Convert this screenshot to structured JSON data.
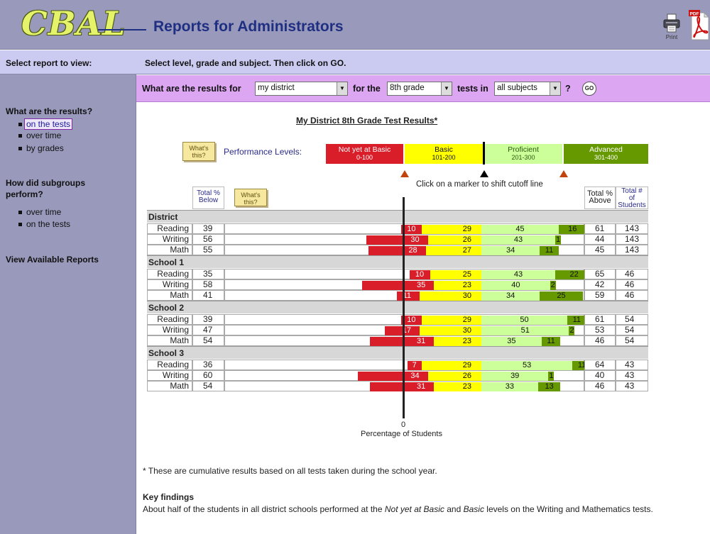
{
  "header": {
    "logo": "CBAL",
    "title": "Reports for Administrators",
    "print_label": "Print",
    "pdf_label": "PDF"
  },
  "sidebar": {
    "heading": "Select report to view:",
    "group1": "What are the results?",
    "group1_items": [
      "on the tests",
      "over time",
      "by grades"
    ],
    "group2_line1": "How did subgroups",
    "group2_line2": "perform?",
    "group2_items": [
      "over time",
      "on the tests"
    ],
    "view_reports": "View Available Reports"
  },
  "instruction": "Select level, grade and subject. Then click on GO.",
  "query": {
    "prefix": "What are the results for",
    "level": "my district",
    "mid": "for the",
    "grade": "8th grade",
    "tests_in": "tests in",
    "subject": "all subjects",
    "question": "?",
    "go": "GO"
  },
  "report": {
    "title": "My District 8th Grade Test Results*",
    "whats_this_line1": "What's",
    "whats_this_line2": "this?",
    "performance_label": "Performance Levels:",
    "levels": [
      {
        "name": "Not yet at Basic",
        "range": "0-100",
        "color": "#d91e2a",
        "text_color": "#ffffff"
      },
      {
        "name": "Basic",
        "range": "101-200",
        "color": "#ffff00",
        "text_color": "#111111"
      },
      {
        "name": "Proficient",
        "range": "201-300",
        "color": "#ccff99",
        "text_color": "#2a5a10"
      },
      {
        "name": "Advanced",
        "range": "301-400",
        "color": "#669900",
        "text_color": "#ffffff"
      }
    ],
    "marker_hint": "Click on a marker to shift cutoff line",
    "headers": {
      "total_below_1": "Total %",
      "total_below_2": "Below",
      "total_above_1": "Total %",
      "total_above_2": "Above",
      "total_students_1": "Total #",
      "total_students_2": "of",
      "total_students_3": "Students"
    },
    "axis_zero": "0",
    "axis_title": "Percentage of Students",
    "footnote": "* These are cumulative results based on all tests taken during the school year.",
    "key_title": "Key findings",
    "key_text_1": "About half of the students in all district schools performed at the ",
    "key_italic_1": "Not yet at Basic",
    "key_text_2": " and ",
    "key_italic_2": "Basic",
    "key_text_3": " levels on the Writing and Mathematics tests."
  },
  "chart_data": {
    "type": "bar",
    "title": "My District 8th Grade Test Results*",
    "xlabel": "Percentage of Students",
    "series_names": [
      "Not yet at Basic",
      "Basic",
      "Proficient",
      "Advanced"
    ],
    "groups": [
      {
        "name": "District",
        "rows": [
          {
            "subject": "Reading",
            "below": 39,
            "nyb": 10,
            "basic": 29,
            "prof": 45,
            "adv": 16,
            "above": 61,
            "students": 143
          },
          {
            "subject": "Writing",
            "below": 56,
            "nyb": 30,
            "basic": 26,
            "prof": 43,
            "adv": 1,
            "above": 44,
            "students": 143
          },
          {
            "subject": "Math",
            "below": 55,
            "nyb": 28,
            "basic": 27,
            "prof": 34,
            "adv": 11,
            "above": 45,
            "students": 143
          }
        ]
      },
      {
        "name": "School 1",
        "rows": [
          {
            "subject": "Reading",
            "below": 35,
            "nyb": 10,
            "basic": 25,
            "prof": 43,
            "adv": 22,
            "above": 65,
            "students": 46
          },
          {
            "subject": "Writing",
            "below": 58,
            "nyb": 35,
            "basic": 23,
            "prof": 40,
            "adv": 2,
            "above": 42,
            "students": 46
          },
          {
            "subject": "Math",
            "below": 41,
            "nyb": 11,
            "basic": 30,
            "prof": 34,
            "adv": 25,
            "above": 59,
            "students": 46
          }
        ]
      },
      {
        "name": "School 2",
        "rows": [
          {
            "subject": "Reading",
            "below": 39,
            "nyb": 10,
            "basic": 29,
            "prof": 50,
            "adv": 11,
            "above": 61,
            "students": 54
          },
          {
            "subject": "Writing",
            "below": 47,
            "nyb": 17,
            "basic": 30,
            "prof": 51,
            "adv": 2,
            "above": 53,
            "students": 54
          },
          {
            "subject": "Math",
            "below": 54,
            "nyb": 31,
            "basic": 23,
            "prof": 35,
            "adv": 11,
            "above": 46,
            "students": 54
          }
        ]
      },
      {
        "name": "School 3",
        "rows": [
          {
            "subject": "Reading",
            "below": 36,
            "nyb": 7,
            "basic": 29,
            "prof": 53,
            "adv": 11,
            "above": 64,
            "students": 43
          },
          {
            "subject": "Writing",
            "below": 60,
            "nyb": 34,
            "basic": 26,
            "prof": 39,
            "adv": 1,
            "above": 40,
            "students": 43
          },
          {
            "subject": "Math",
            "below": 54,
            "nyb": 31,
            "basic": 23,
            "prof": 33,
            "adv": 13,
            "above": 46,
            "students": 43
          }
        ]
      }
    ]
  }
}
